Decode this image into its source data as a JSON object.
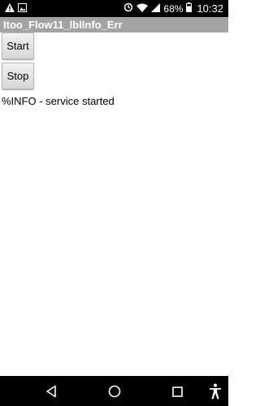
{
  "status_bar": {
    "battery_percent": "68%",
    "time": "10:32",
    "icons": [
      "warning-icon",
      "image-icon",
      "sync-icon",
      "wifi-icon",
      "signal-icon",
      "battery-icon"
    ]
  },
  "title_bar": {
    "title": "Itoo_Flow11_lblInfo_Err"
  },
  "buttons": {
    "start_label": "Start",
    "stop_label": "Stop"
  },
  "info": {
    "text": "%INFO - service started"
  },
  "nav_bar": {
    "icons": [
      "back-icon",
      "home-icon",
      "recents-icon",
      "accessibility-icon"
    ]
  },
  "colors": {
    "title_bar_bg": "#a3a3a3",
    "status_bar_bg": "#000000",
    "nav_bar_bg": "#000000"
  }
}
